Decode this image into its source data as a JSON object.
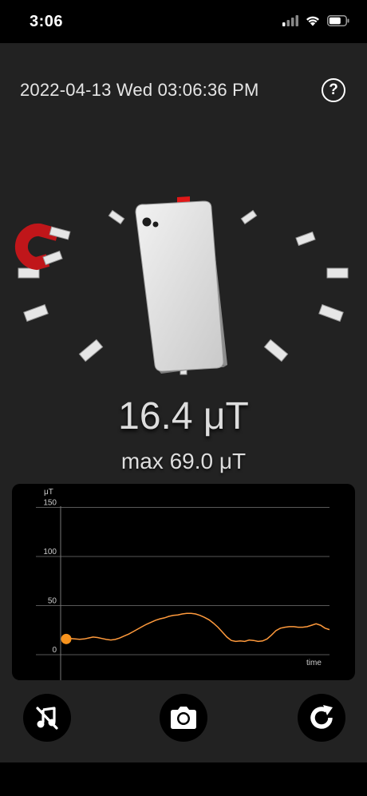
{
  "status_bar": {
    "time": "3:06",
    "icons": [
      "cellular-signal-icon",
      "wifi-icon",
      "battery-icon"
    ]
  },
  "header": {
    "datetime": "2022-04-13 Wed 03:06:36 PM",
    "help_icon": "?"
  },
  "readout": {
    "current": "16.4 μT",
    "max": "max 69.0 μT"
  },
  "chart_data": {
    "type": "line",
    "ylabel": "μT",
    "xlabel": "time",
    "y_ticks": [
      "0",
      "50",
      "100",
      "150"
    ],
    "ylim": [
      0,
      160
    ],
    "line_color": "#ff9a3c",
    "marker_color": "#f7931e",
    "series": [
      {
        "values": [
          16,
          16.4,
          16,
          15.6,
          16,
          17,
          18,
          17.5,
          16.5,
          15.5,
          15,
          15.5,
          17,
          19,
          21,
          23.5,
          26,
          28.5,
          31,
          33,
          35,
          36.5,
          37.5,
          39,
          40,
          40.5,
          41.5,
          42,
          42,
          41.5,
          40,
          38,
          35.5,
          32,
          28,
          23,
          18,
          14.5,
          13.5,
          14,
          13.5,
          15,
          14.5,
          13.5,
          14,
          16,
          20,
          24.5,
          27,
          28,
          28.5,
          28.5,
          28,
          28,
          28.5,
          30,
          31.5,
          30,
          27,
          25.5
        ]
      }
    ]
  },
  "controls": {
    "mute": "mute-sound-icon",
    "camera": "camera-icon",
    "reset": "reset-icon"
  }
}
